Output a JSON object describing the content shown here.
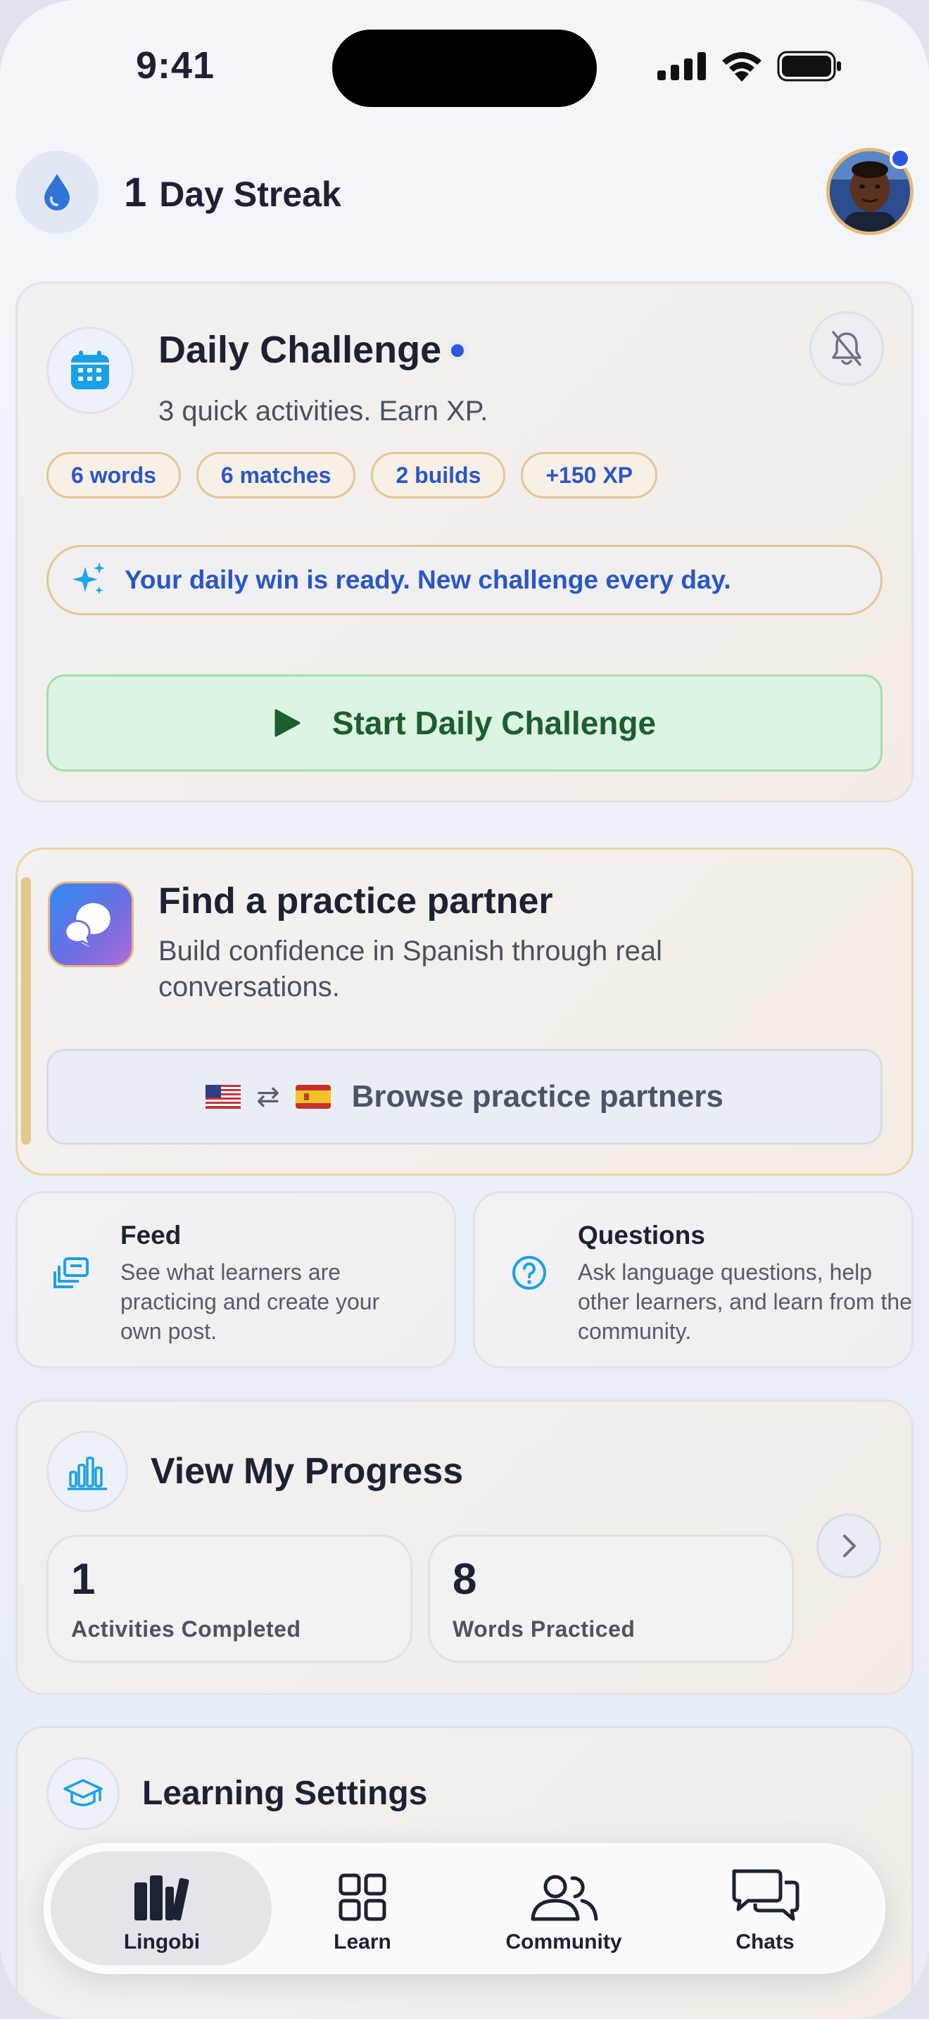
{
  "status_bar": {
    "time": "9:41"
  },
  "header": {
    "streak_count": "1",
    "streak_label": "Day Streak"
  },
  "daily_challenge": {
    "title": "Daily Challenge",
    "subtitle": "3 quick activities. Earn XP.",
    "pills": [
      "6 words",
      "6 matches",
      "2 builds",
      "+150 XP"
    ],
    "banner": "Your daily win is ready. New challenge every day.",
    "start_label": "Start Daily Challenge"
  },
  "partner": {
    "title": "Find a practice partner",
    "subtitle": "Build confidence in Spanish through real conversations.",
    "browse_label": "Browse practice partners",
    "swap_glyph": "⇄"
  },
  "feed": {
    "title": "Feed",
    "text": "See what learners are practicing and create your own post."
  },
  "questions": {
    "title": "Questions",
    "text": "Ask language questions, help other learners, and learn from the community."
  },
  "progress": {
    "title": "View My Progress",
    "stats": [
      {
        "value": "1",
        "label": "Activities Completed"
      },
      {
        "value": "8",
        "label": "Words Practiced"
      }
    ]
  },
  "settings": {
    "title": "Learning Settings"
  },
  "tabs": [
    {
      "label": "Lingobi",
      "icon": "books-icon",
      "active": true
    },
    {
      "label": "Learn",
      "icon": "grid-icon",
      "active": false
    },
    {
      "label": "Community",
      "icon": "people-icon",
      "active": false
    },
    {
      "label": "Chats",
      "icon": "chat-bubbles-icon",
      "active": false
    }
  ],
  "colors": {
    "accent_blue": "#2c55e0",
    "pill_border": "#e4c594",
    "start_green": "#1c5e2f",
    "start_bg": "#dcf5e2"
  }
}
